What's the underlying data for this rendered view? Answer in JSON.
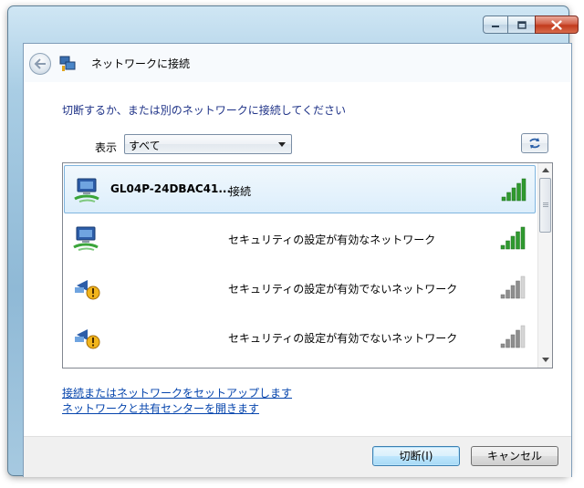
{
  "window": {
    "title": "ネットワークに接続"
  },
  "heading": "切断するか、または別のネットワークに接続してください",
  "filter": {
    "label": "表示",
    "selected": "すべて"
  },
  "networks": [
    {
      "ssid": "GL04P-24DBAC41...",
      "status": "接続",
      "icon": "wireless-network-icon",
      "signal_bars": 5,
      "selected": true,
      "signal_color": "#2f9a2f"
    },
    {
      "ssid": "",
      "status": "セキュリティの設定が有効なネットワーク",
      "icon": "wireless-network-icon",
      "signal_bars": 5,
      "selected": false,
      "signal_color": "#2f9a2f"
    },
    {
      "ssid": "",
      "status": "セキュリティの設定が有効でないネットワーク",
      "icon": "unsecured-network-warning-icon",
      "signal_bars": 4,
      "selected": false,
      "signal_color": "#8e8e8e"
    },
    {
      "ssid": "",
      "status": "セキュリティの設定が有効でないネットワーク",
      "icon": "unsecured-network-warning-icon",
      "signal_bars": 4,
      "selected": false,
      "signal_color": "#8e8e8e"
    }
  ],
  "links": {
    "setup": "接続またはネットワークをセットアップします",
    "sharing_center": "ネットワークと共有センターを開きます"
  },
  "buttons": {
    "disconnect": "切断(I)",
    "cancel": "キャンセル"
  },
  "colors": {
    "heading": "#1e3287",
    "link": "#0645ad",
    "signal_active": "#2f9a2f",
    "signal_inactive": "#8e8e8e",
    "close_button": "#c23a1c"
  }
}
